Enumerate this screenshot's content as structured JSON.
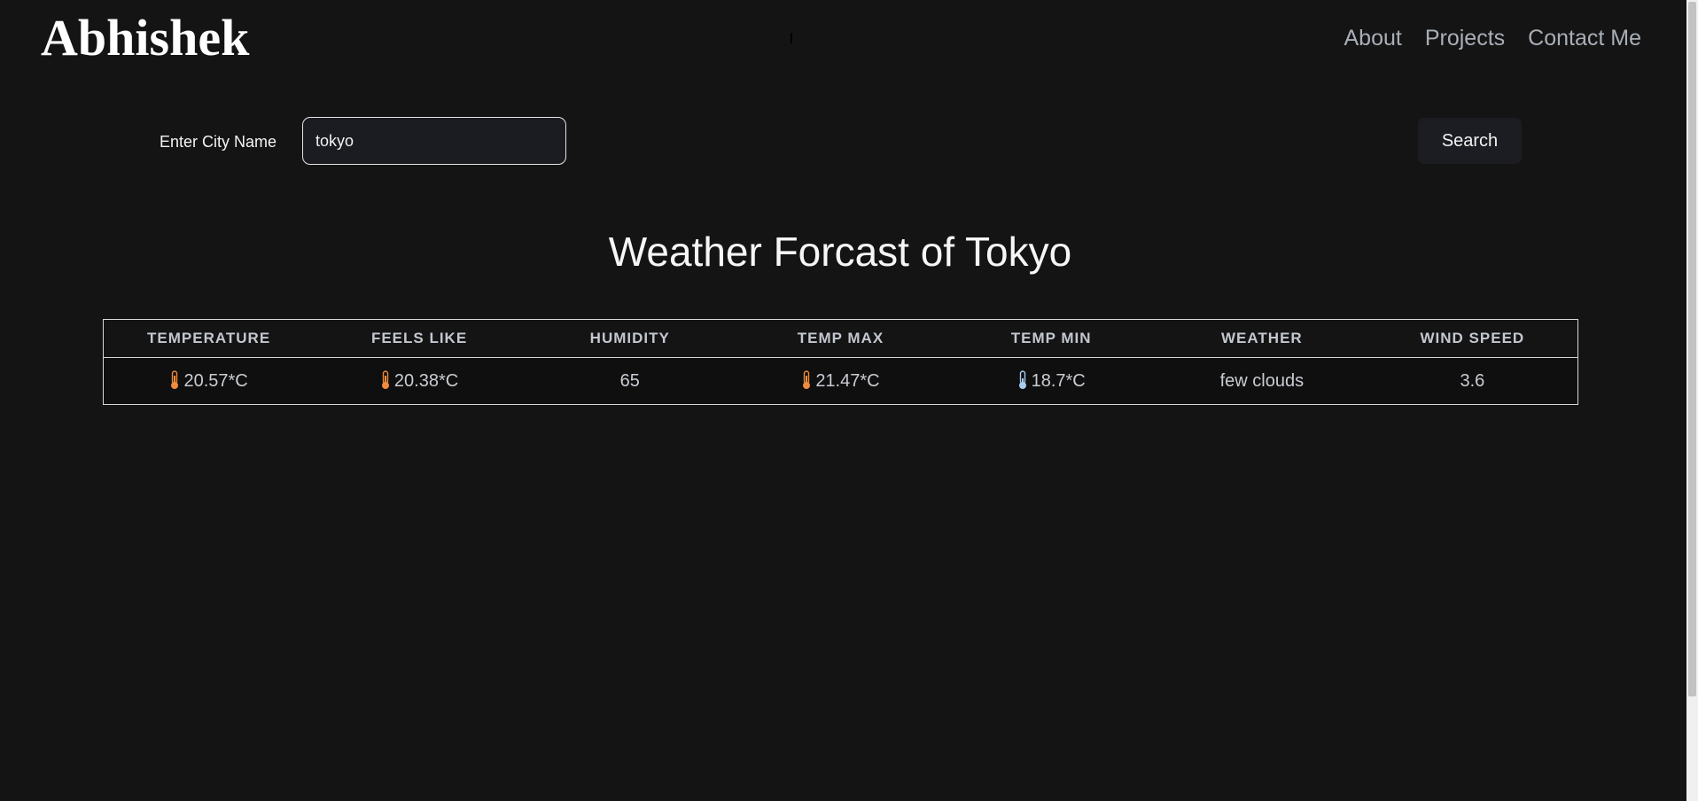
{
  "header": {
    "brand": "Abhishek",
    "nav": [
      "About",
      "Projects",
      "Contact Me"
    ]
  },
  "search": {
    "label": "Enter City Name",
    "value": "tokyo",
    "button_label": "Search"
  },
  "forecast": {
    "title": "Weather Forcast of Tokyo",
    "columns": [
      "TEMPERATURE",
      "FEELS LIKE",
      "HUMIDITY",
      "TEMP MAX",
      "TEMP MIN",
      "WEATHER",
      "WIND SPEED"
    ],
    "row": {
      "temperature": "20.57*C",
      "feels_like": "20.38*C",
      "humidity": "65",
      "temp_max": "21.47*C",
      "temp_min": "18.7*C",
      "weather": "few clouds",
      "wind_speed": "3.6"
    }
  },
  "icons": {
    "warm": "thermometer-warm-icon",
    "cool": "thermometer-cool-icon"
  },
  "colors": {
    "background": "#141414",
    "warm_thermometer": "#f08a3c",
    "cool_thermometer": "#a9cdf0"
  }
}
